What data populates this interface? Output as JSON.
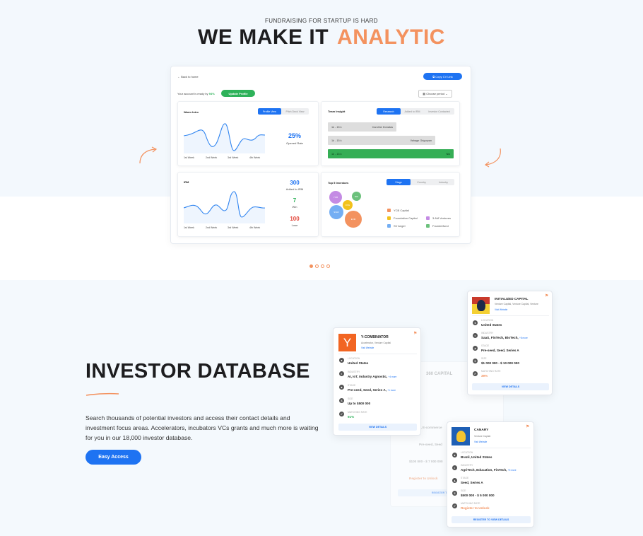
{
  "hero": {
    "eyebrow": "FUNDRAISING FOR STARTUP IS HARD",
    "title_main": "WE MAKE IT",
    "title_accent": "ANALYTIC"
  },
  "dashboard": {
    "back": "Back to home",
    "copy_link": "Copy CV Link",
    "account_ready_prefix": "Your account is ready by",
    "account_ready_pct": "94%",
    "update_profile": "Update Profile",
    "choose_period": "Choose period",
    "warm_intro": {
      "title": "Warm Intro",
      "tabs": [
        "Profile View",
        "Pitch Deck View"
      ],
      "value": "25%",
      "value_label": "Opened Rate",
      "x_ticks": [
        "1st Week",
        "2nd Week",
        "3rd Week",
        "4th Week"
      ]
    },
    "team_insight": {
      "title": "Team Insight",
      "tabs": [
        "Research",
        "Added to IRM",
        "Investor Contacted"
      ],
      "rows": [
        {
          "range": "1k - 15 k",
          "name": "Caroline Donatas"
        },
        {
          "range": "1k - 15 k",
          "name": "Vahagn Grigoryan"
        },
        {
          "range": "1k - 15 k",
          "name": "Nik"
        }
      ]
    },
    "irm": {
      "title": "IRM",
      "added": "300",
      "added_label": "Added to IRM",
      "win": "7",
      "win_label": "Win",
      "lose": "100",
      "lose_label": "Lose",
      "x_ticks": [
        "1st Week",
        "2nd Week",
        "3rd Week",
        "4th Week"
      ]
    },
    "top5": {
      "title": "Top 5 Investors",
      "tabs": [
        "Stage",
        "Country",
        "Industry"
      ],
      "bubbles": [
        "YCB",
        "500",
        "FNG",
        "SVAV",
        "EXM"
      ],
      "legend": [
        "YCB Capital",
        "3 AM Ventures",
        "Foundation Capital",
        "Founderfund",
        "SV Angel"
      ]
    },
    "colors": {
      "accent": "#f3925f",
      "blue": "#1e73f2",
      "green": "#2eb25a"
    }
  },
  "carousel": {
    "active": 0,
    "count": 4
  },
  "investor": {
    "title": "INVESTOR DATABASE",
    "description": "Search thousands of potential investors and access their contact details and investment focus areas. Accelerators, incubators VCs grants and much more is waiting for you in our 18,000 investor database.",
    "cta": "Easy Access",
    "ghost": {
      "name": "360 CAPITAL",
      "f1": "P, E-commerce",
      "f2": "Pre-seed, Seed",
      "f3": "$100 000 - $ 7 000 000",
      "f4": "Register to Unlock",
      "button": "REGISTER TO"
    },
    "cards": [
      {
        "name": "Y-COMBINATOR",
        "sub": "Accelerator, Venture Capital",
        "link": "Visit Website",
        "location_label": "LOCATION",
        "location": "United States",
        "industry_label": "INDUSTRY",
        "industry": "AI, IoT, Industry Agnostic,",
        "industry_more": "+4 more",
        "stage_label": "STAGE",
        "stage": "Pre-seed, Seed, Series A,",
        "stage_more": "+1 more",
        "size_label": "SIZE",
        "size": "Up to $500 000",
        "match_label": "MATCHING RATE",
        "match": "91%",
        "button": "VIEW DETAILS"
      },
      {
        "name": "INITIALIZED CAPITAL",
        "sub": "Venture Capital, Venture Capital, Venture",
        "link": "Visit Website",
        "location_label": "LOCATION",
        "location": "United States",
        "industry_label": "INDUSTRY",
        "industry": "SaaS, FinTech, BioTech,",
        "industry_more": "+8 more",
        "stage_label": "STAGE",
        "stage": "Pre-seed, Seed, Series A",
        "size_label": "SIZE",
        "size": "$1 000 000 - $ 10 000 000",
        "match_label": "MATCHING RATE",
        "match": "39%",
        "button": "VIEW DETAILS"
      },
      {
        "name": "CANARY",
        "sub": "Venture Capital",
        "link": "Visit Website",
        "location_label": "LOCATION",
        "location": "Brazil, United States",
        "industry_label": "INDUSTRY",
        "industry": "AgriTech, Education, FinTech,",
        "industry_more": "+5 more",
        "stage_label": "STAGE",
        "stage": "Seed, Series A",
        "size_label": "SIZE",
        "size": "$500 000 - $ 5 000 000",
        "match_label": "MATCHING RATE",
        "match": "Register to Unlock",
        "button": "REGISTER TO VIEW DETAILS"
      }
    ]
  }
}
